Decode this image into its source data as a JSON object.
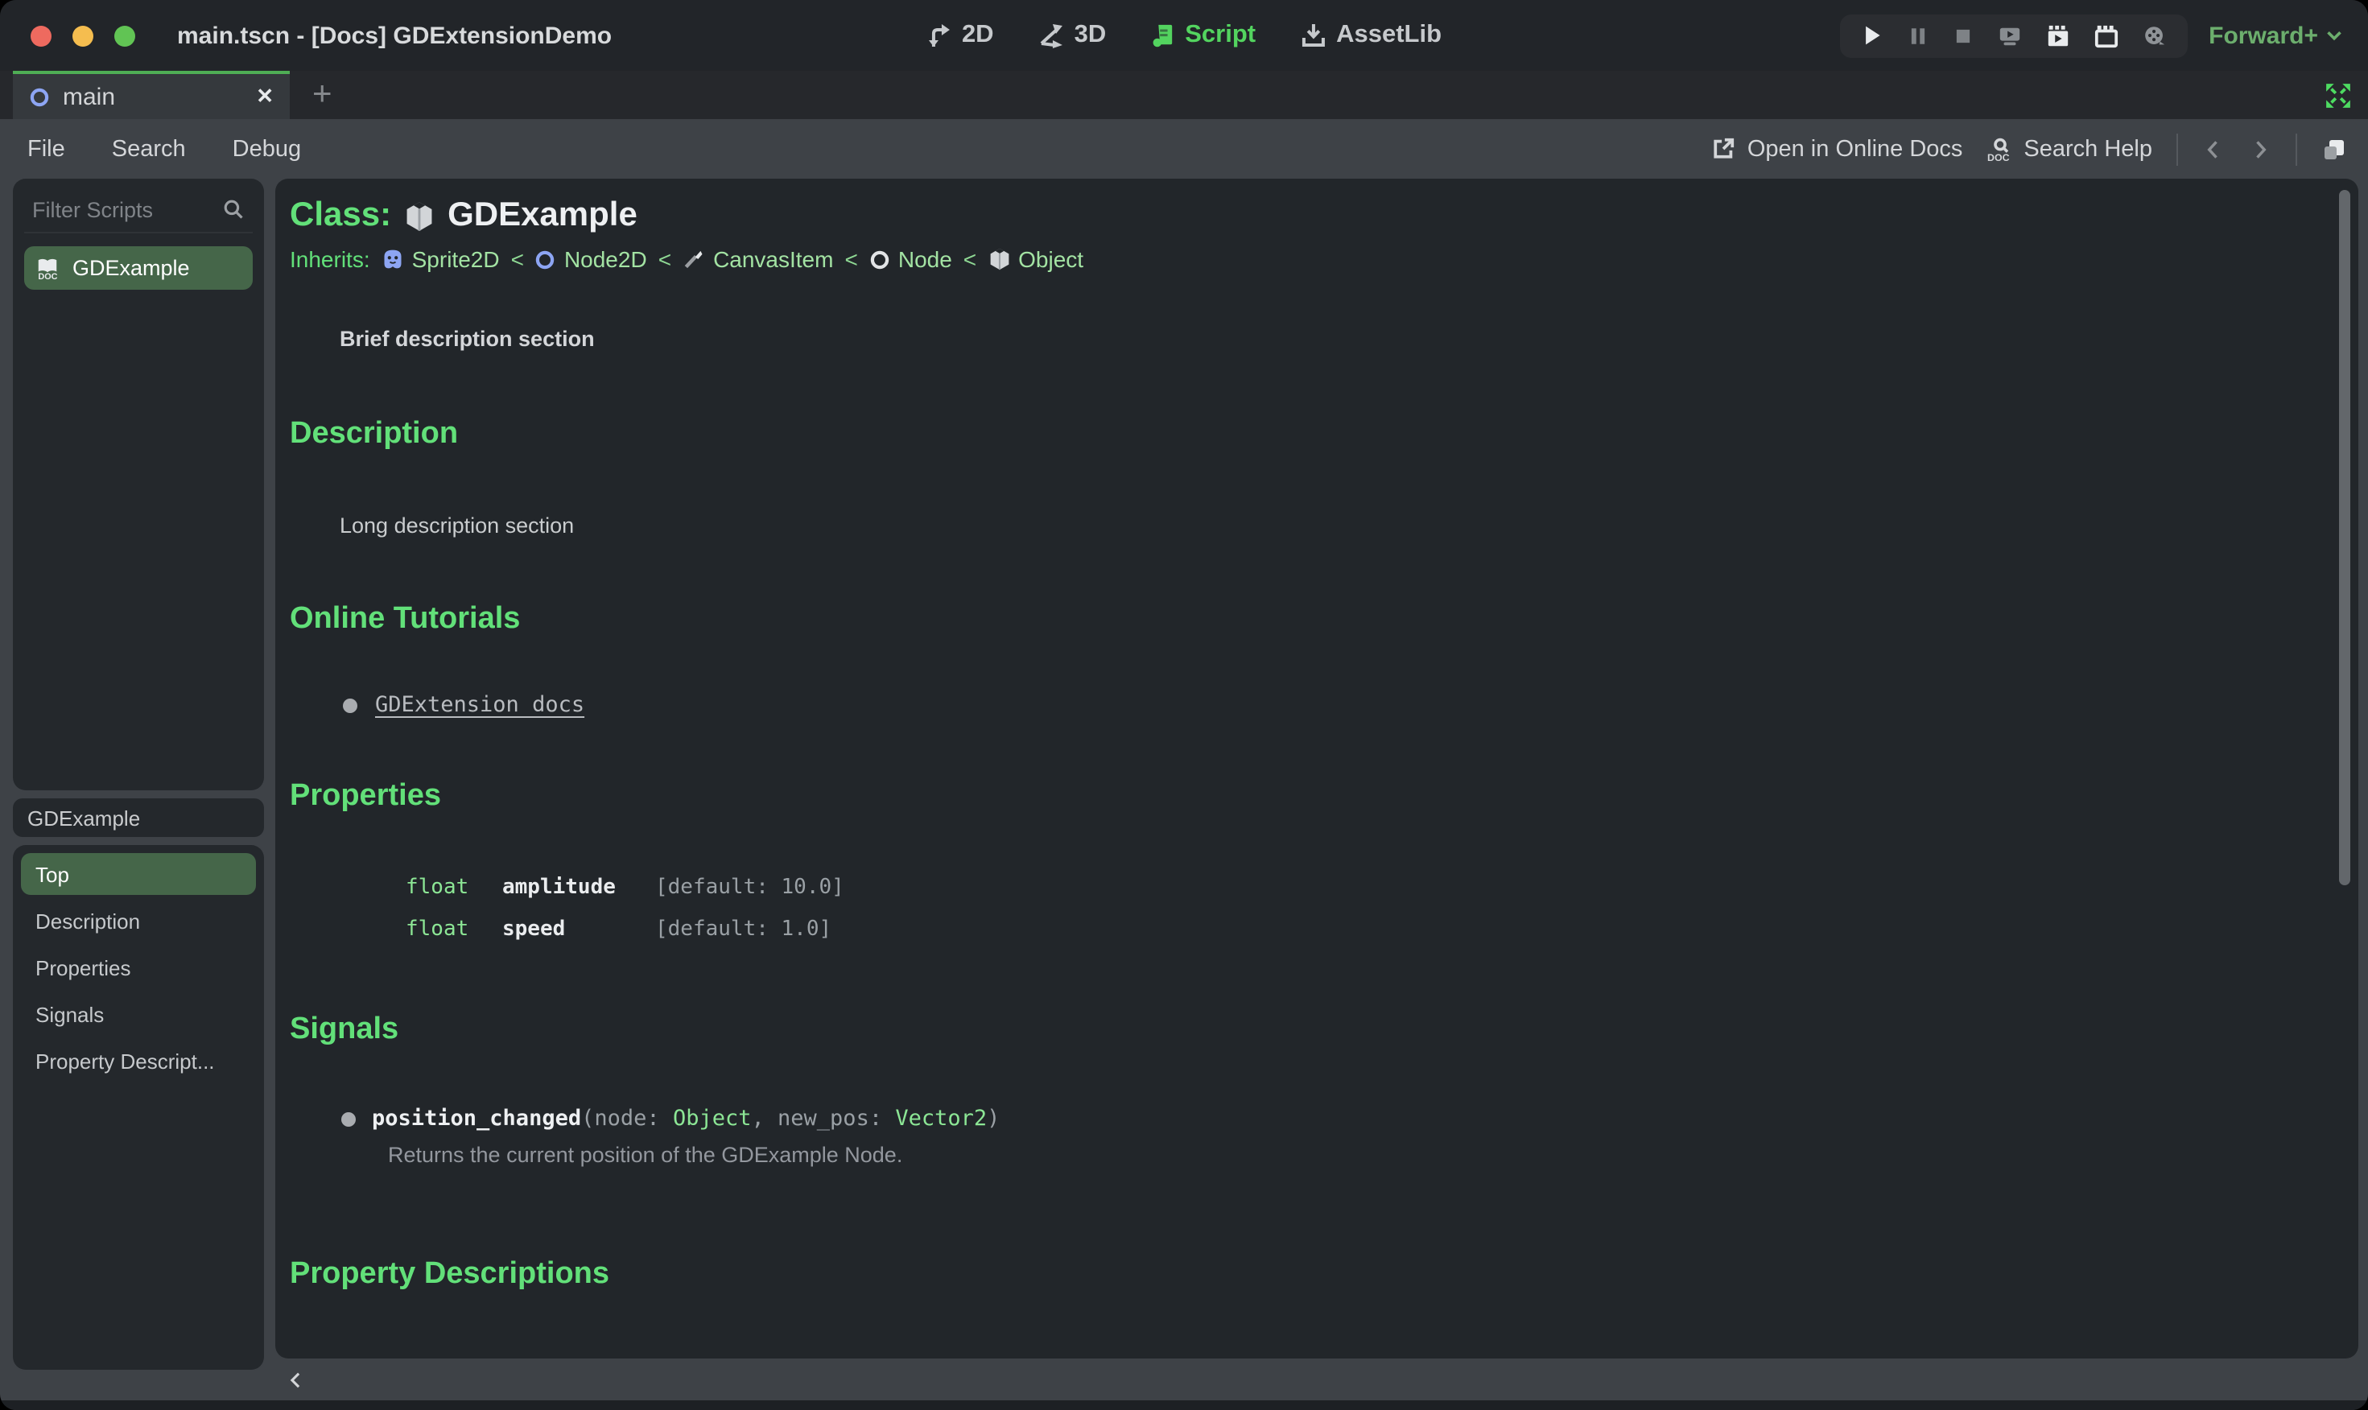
{
  "window": {
    "title": "main.tscn - [Docs] GDExtensionDemo"
  },
  "workspace_tabs": [
    {
      "label": "2D"
    },
    {
      "label": "3D"
    },
    {
      "label": "Script"
    },
    {
      "label": "AssetLib"
    }
  ],
  "run_bar": {
    "mode": "Forward+"
  },
  "scene_tabs": {
    "active_tab": "main",
    "add_label": "+",
    "close_label": "✕"
  },
  "menubar": {
    "file": "File",
    "search": "Search",
    "debug": "Debug",
    "open_online_docs": "Open in Online Docs",
    "search_help": "Search Help"
  },
  "scripts_panel": {
    "filter_placeholder": "Filter Scripts",
    "items": [
      {
        "name": "GDExample"
      }
    ]
  },
  "outline": {
    "header": "GDExample",
    "items": [
      "Top",
      "Description",
      "Properties",
      "Signals",
      "Property Descript..."
    ]
  },
  "doc": {
    "class_label": "Class:",
    "class_name": "GDExample",
    "inherits_label": "Inherits:",
    "separator": "<",
    "inherits": [
      {
        "name": "Sprite2D"
      },
      {
        "name": "Node2D"
      },
      {
        "name": "CanvasItem"
      },
      {
        "name": "Node"
      },
      {
        "name": "Object"
      }
    ],
    "brief": "Brief description section",
    "description_title": "Description",
    "description_body": "Long description section",
    "tutorials_title": "Online Tutorials",
    "tutorial_link": "GDExtension docs",
    "properties_title": "Properties",
    "properties": [
      {
        "type": "float",
        "name": "amplitude",
        "default": "[default: 10.0]"
      },
      {
        "type": "float",
        "name": "speed",
        "default": "[default: 1.0]"
      }
    ],
    "signals_title": "Signals",
    "signal": {
      "name": "position_changed",
      "open_paren": "(",
      "param1_label": "node: ",
      "param1_type": "Object",
      "comma": ", ",
      "param2_label": "new_pos: ",
      "param2_type": "Vector2",
      "close_paren": ")",
      "description": "Returns the current position of the GDExample Node."
    },
    "property_descriptions_title": "Property Descriptions"
  },
  "colors": {
    "accent_green": "#62e079",
    "link_green": "#a3e3a3",
    "selected_row_green": "#456649",
    "script_tab_green": "#53d45f",
    "run_mode_green": "#6cae6d",
    "panel_dark": "#24282c",
    "editor_gray": "#3e4247"
  }
}
